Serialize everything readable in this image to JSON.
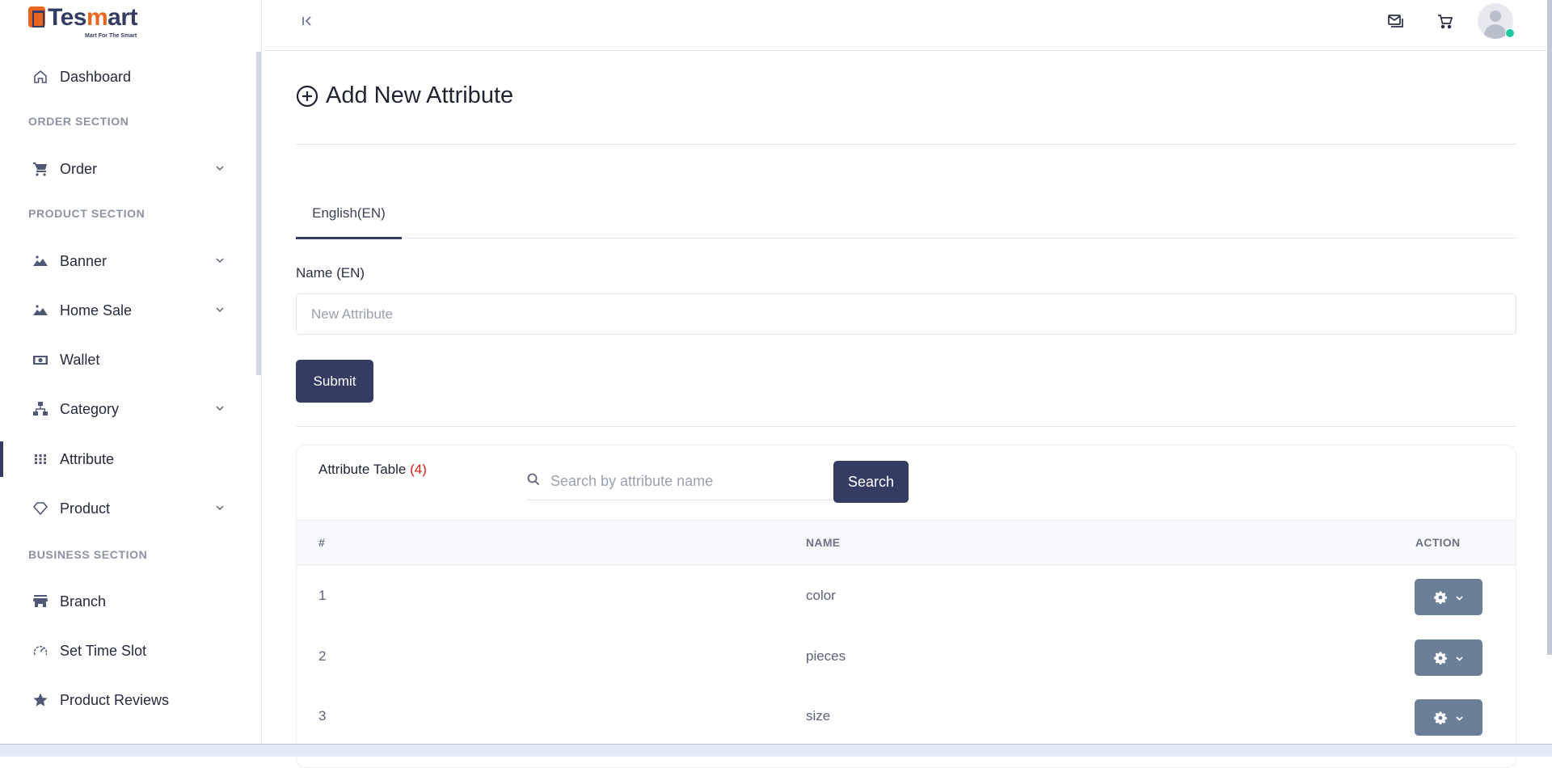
{
  "brand": {
    "name_left": "Tes",
    "name_accent": "m",
    "name_right": "art",
    "tagline": "Mart For The Smart",
    "accent_color": "#e8651e",
    "primary_color": "#353c63"
  },
  "sidebar": {
    "items": [
      {
        "label": "Dashboard",
        "icon": "home-icon",
        "has_submenu": false
      },
      {
        "section": "ORDER SECTION"
      },
      {
        "label": "Order",
        "icon": "cart-icon",
        "has_submenu": true
      },
      {
        "section": "PRODUCT SECTION"
      },
      {
        "label": "Banner",
        "icon": "image-icon",
        "has_submenu": true
      },
      {
        "label": "Home Sale",
        "icon": "image-icon",
        "has_submenu": true
      },
      {
        "label": "Wallet",
        "icon": "money-icon",
        "has_submenu": false
      },
      {
        "label": "Category",
        "icon": "sitemap-icon",
        "has_submenu": true
      },
      {
        "label": "Attribute",
        "icon": "grid-icon",
        "has_submenu": false,
        "active": true
      },
      {
        "label": "Product",
        "icon": "diamond-icon",
        "has_submenu": true
      },
      {
        "section": "BUSINESS SECTION"
      },
      {
        "label": "Branch",
        "icon": "store-icon",
        "has_submenu": false
      },
      {
        "label": "Set Time Slot",
        "icon": "speedometer-icon",
        "has_submenu": false
      },
      {
        "label": "Product Reviews",
        "icon": "star-icon",
        "has_submenu": false
      }
    ]
  },
  "topbar": {
    "icons": [
      "messages-icon",
      "cart-icon",
      "avatar"
    ],
    "online_status_color": "#1dc9a0"
  },
  "page": {
    "title": "Add New Attribute",
    "tabs": [
      {
        "label": "English(EN)",
        "active": true
      }
    ],
    "form": {
      "name_label": "Name (EN)",
      "name_placeholder": "New Attribute",
      "name_value": "",
      "submit_label": "Submit"
    },
    "table": {
      "title": "Attribute Table",
      "count": "(4)",
      "search_placeholder": "Search by attribute name",
      "search_value": "",
      "search_label": "Search",
      "columns": [
        "#",
        "NAME",
        "ACTION"
      ],
      "rows": [
        {
          "index": "1",
          "name": "color"
        },
        {
          "index": "2",
          "name": "pieces"
        },
        {
          "index": "3",
          "name": "size"
        }
      ]
    }
  }
}
